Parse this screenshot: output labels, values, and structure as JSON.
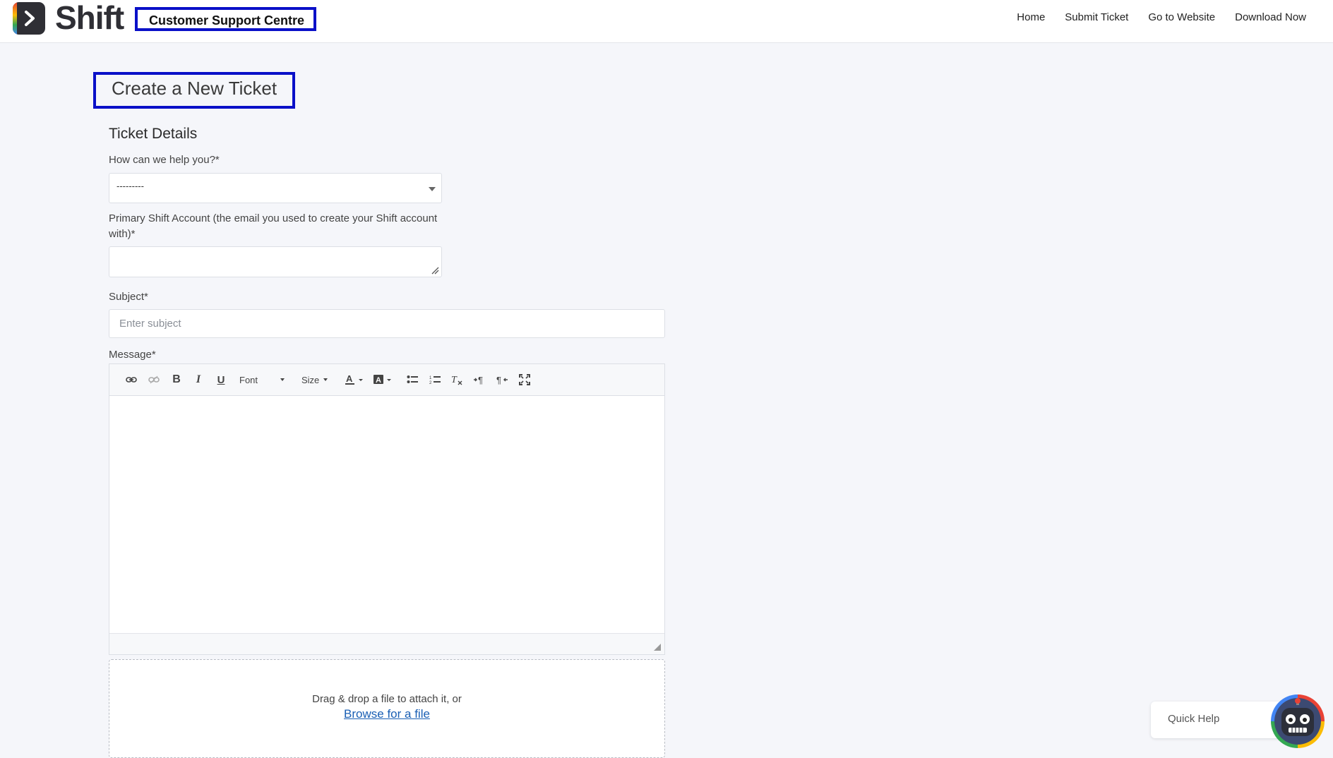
{
  "brand": {
    "name": "Shift",
    "site_title": "Customer Support Centre"
  },
  "nav": {
    "items": [
      "Home",
      "Submit Ticket",
      "Go to Website",
      "Download Now"
    ]
  },
  "page": {
    "title": "Create a New Ticket",
    "section_title": "Ticket Details"
  },
  "form": {
    "help_label": "How can we help you?*",
    "help_selected": "---------",
    "account_label": "Primary Shift Account (the email you used to create your Shift account with)*",
    "account_value": "",
    "subject_label": "Subject*",
    "subject_placeholder": "Enter subject",
    "message_label": "Message*"
  },
  "editor_toolbar": {
    "font_label": "Font",
    "size_label": "Size",
    "buttons": [
      "link-icon",
      "unlink-icon",
      "bold-icon",
      "italic-icon",
      "underline-icon",
      "font-dropdown",
      "size-dropdown",
      "text-color-icon",
      "background-color-icon",
      "bulleted-list-icon",
      "numbered-list-icon",
      "remove-format-icon",
      "ltr-icon",
      "rtl-icon",
      "maximize-icon"
    ]
  },
  "dropzone": {
    "text": "Drag & drop a file to attach it, or",
    "link": "Browse for a file"
  },
  "widget": {
    "quick_help": "Quick Help"
  },
  "colors": {
    "highlight_box": "#0a10c8",
    "link": "#1a5fb4",
    "background": "#f5f6fa"
  }
}
